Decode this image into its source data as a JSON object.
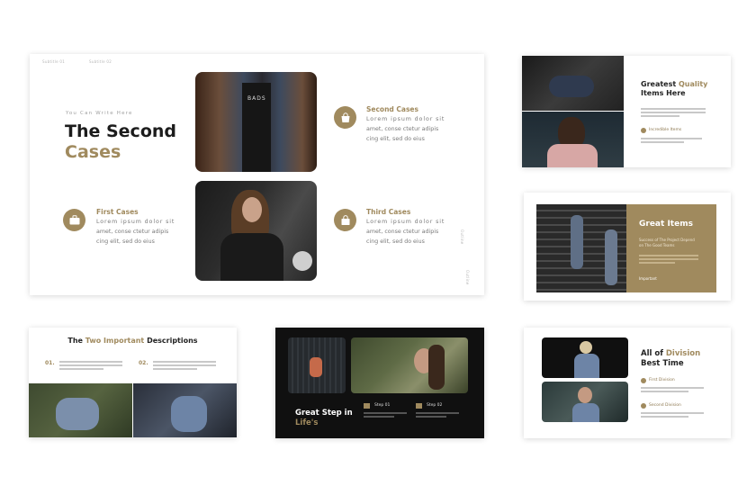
{
  "main": {
    "tab1": "Subtitle 01",
    "tab2": "Subtitle 02",
    "kicker": "You Can Write Here",
    "title_line1": "The Second",
    "title_line2": "Cases",
    "cases": [
      {
        "title": "First Cases",
        "body_l1": "Lorem ipsum dolor sit",
        "body_l2": "amet, conse ctetur adipis",
        "body_l3": "cing elit, sed do eius"
      },
      {
        "title": "Second Cases",
        "body_l1": "Lorem ipsum dolor sit",
        "body_l2": "amet, conse ctetur adipis",
        "body_l3": "cing elit, sed do eius"
      },
      {
        "title": "Third Cases",
        "body_l1": "Lorem ipsum dolor sit",
        "body_l2": "amet, conse ctetur adipis",
        "body_l3": "cing elit, sed do eius"
      }
    ],
    "side_label1": "Outline",
    "side_label2": "Outline"
  },
  "quality": {
    "title_part1": "Greatest",
    "title_part2": "Quality",
    "title_line2": "Items Here",
    "feature": "Incredible Items"
  },
  "great_items": {
    "title": "Great Items",
    "subtitle_l1": "Success of The Project Depend",
    "subtitle_l2": "on The Good Teams",
    "foot": "Important"
  },
  "descriptions": {
    "title_part1": "The",
    "title_part2": "Two Important",
    "title_part3": "Descriptions",
    "n1": "01.",
    "n2": "02."
  },
  "dark": {
    "title_line1": "Great Step in",
    "title_line2": "Life's",
    "step1": "Step 01",
    "step2": "Step 02"
  },
  "division": {
    "title_part1": "All of",
    "title_part2": "Division",
    "title_line2": "Best Time",
    "item1": "First Division",
    "item2": "Second Division"
  }
}
